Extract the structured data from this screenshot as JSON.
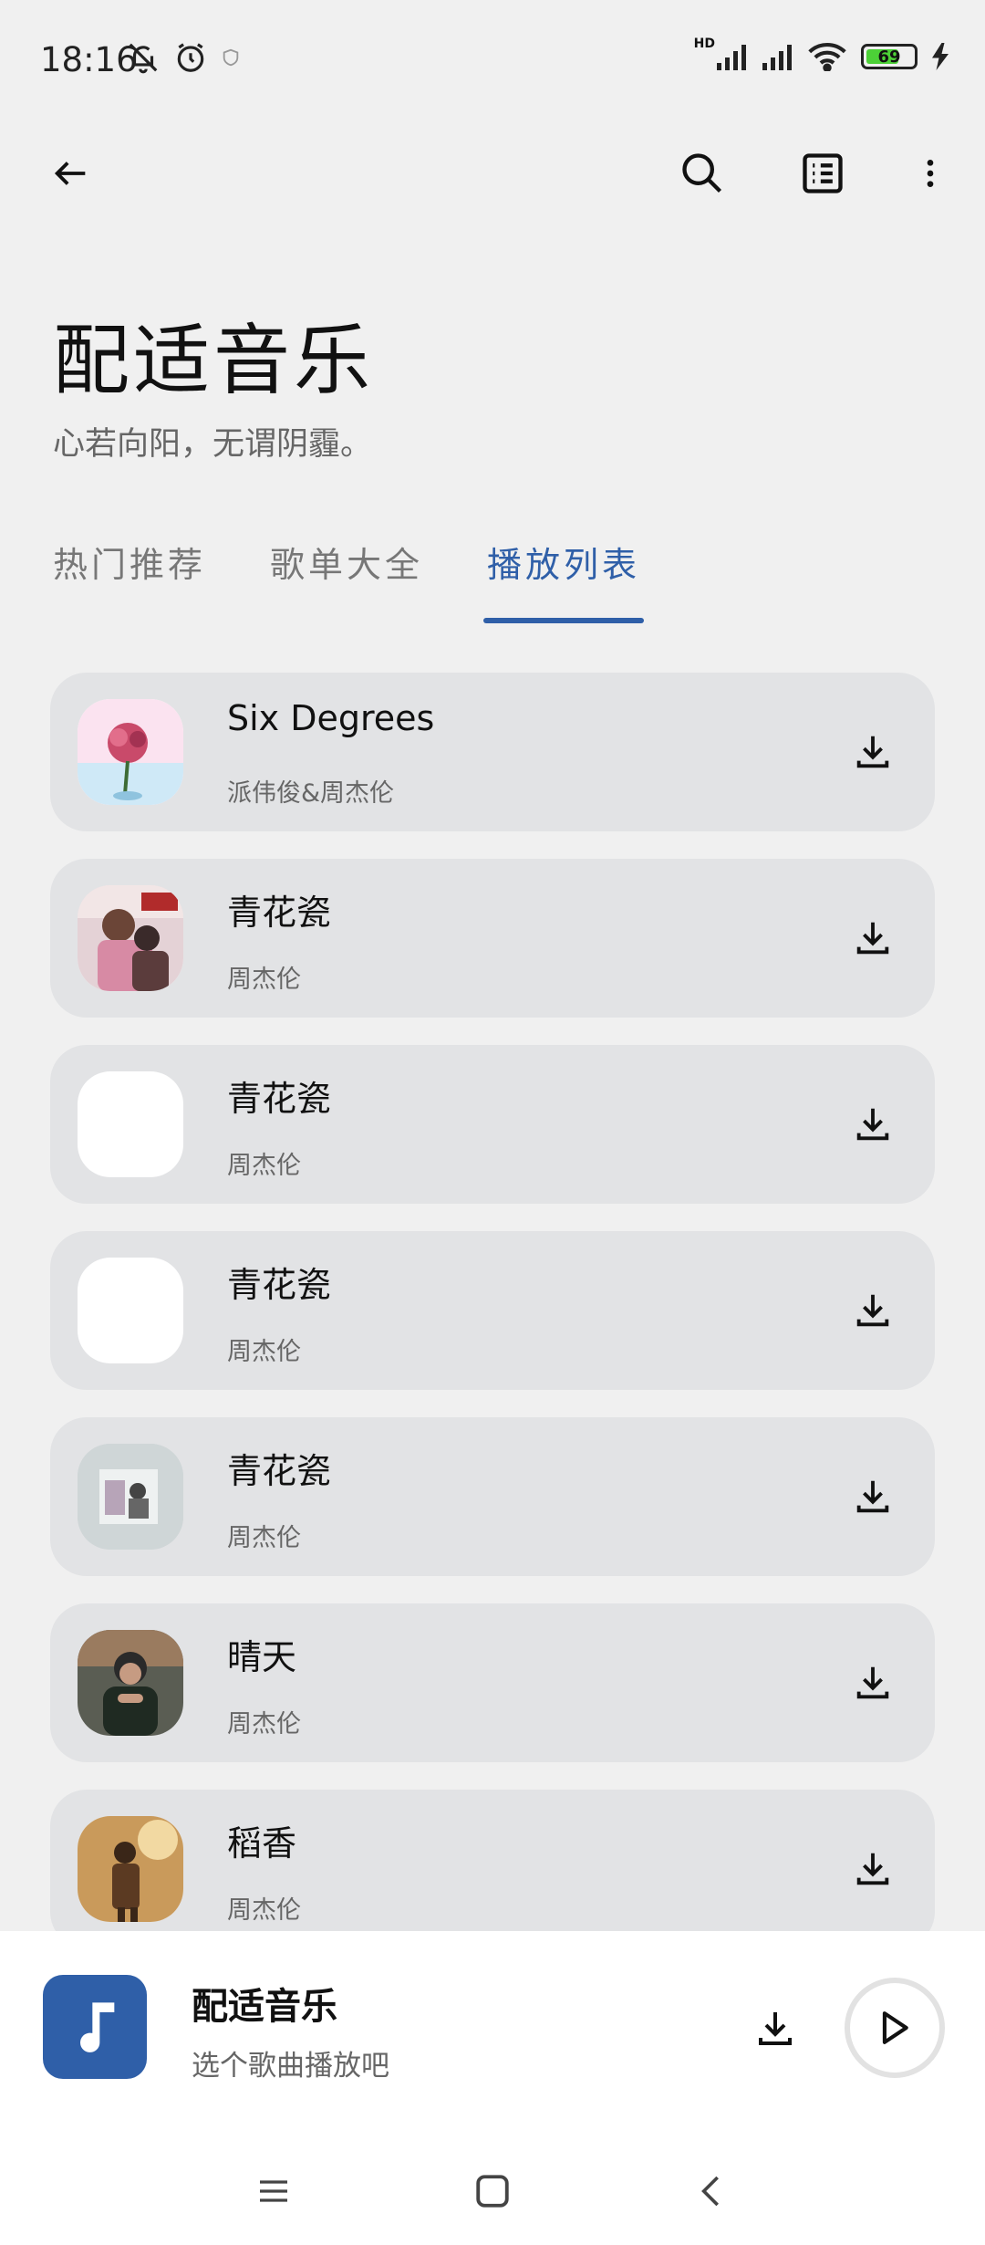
{
  "status_bar": {
    "time": "18:16",
    "network_badge": "HD",
    "battery_level": "69",
    "battery_fraction": 0.69
  },
  "toolbar": {
    "back_icon": "back-arrow-icon",
    "search_icon": "search-icon",
    "list_icon": "list-icon",
    "more_icon": "more-vertical-icon"
  },
  "header": {
    "title": "配适音乐",
    "subtitle": "心若向阳，无谓阴霾。"
  },
  "tabs": [
    {
      "label": "热门推荐",
      "active": false
    },
    {
      "label": "歌单大全",
      "active": false
    },
    {
      "label": "播放列表",
      "active": true
    }
  ],
  "songs": [
    {
      "title": "Six Degrees",
      "artist": "派伟俊&周杰伦",
      "cover": "six-degrees"
    },
    {
      "title": "青花瓷",
      "artist": "周杰伦",
      "cover": "jay-pink"
    },
    {
      "title": "青花瓷",
      "artist": "周杰伦",
      "cover": "blank"
    },
    {
      "title": "青花瓷",
      "artist": "周杰伦",
      "cover": "blank"
    },
    {
      "title": "青花瓷",
      "artist": "周杰伦",
      "cover": "grey-photo"
    },
    {
      "title": "晴天",
      "artist": "周杰伦",
      "cover": "dark-portrait"
    },
    {
      "title": "稻香",
      "artist": "周杰伦",
      "cover": "sepia"
    }
  ],
  "player": {
    "title": "配适音乐",
    "subtitle": "选个歌曲播放吧",
    "cover_icon": "music-note-icon",
    "accent_color": "#2f5fa8"
  },
  "nav_bar": {
    "menu_icon": "menu-icon",
    "home_icon": "home-square-icon",
    "back_icon": "back-chevron-icon"
  }
}
